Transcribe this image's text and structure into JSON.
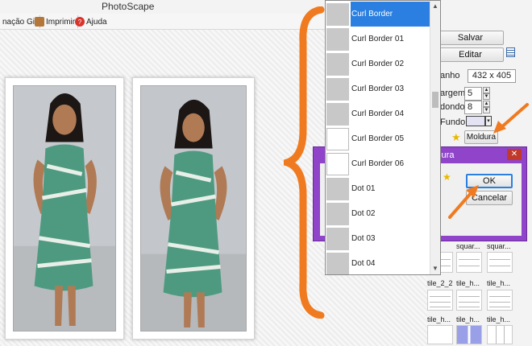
{
  "window": {
    "title": "PhotoScape",
    "minimize": "−",
    "restore": "❐",
    "close": "✕"
  },
  "toolbar": {
    "items": [
      {
        "label": "nação Gif",
        "icon": "gif-icon"
      },
      {
        "label": "Imprimir",
        "icon": "printer-icon"
      },
      {
        "label": "Ajuda",
        "icon": "help-icon"
      }
    ]
  },
  "frame_list": {
    "items": [
      {
        "label": "Curl Border",
        "selected": true
      },
      {
        "label": "Curl Border 01"
      },
      {
        "label": "Curl Border 02"
      },
      {
        "label": "Curl Border 03"
      },
      {
        "label": "Curl Border 04"
      },
      {
        "label": "Curl Border 05"
      },
      {
        "label": "Curl Border 06"
      },
      {
        "label": "Dot 01"
      },
      {
        "label": "Dot 02"
      },
      {
        "label": "Dot 03"
      },
      {
        "label": "Dot 04"
      }
    ],
    "scroll_up": "▲",
    "scroll_down": "▼"
  },
  "panel": {
    "save_label": "Salvar",
    "edit_label": "Editar",
    "size_label": "anho",
    "size_value": "432 x 405",
    "margin_label": "argem",
    "margin_value": "5",
    "round_label": "dondo",
    "round_value": "8",
    "background_label": "Fundo",
    "frame_label": "Moldura"
  },
  "dialog": {
    "title": "ldura",
    "ok_label": "OK",
    "cancel_label": "Cancelar",
    "close": "✕"
  },
  "thumbnails": {
    "names": [
      "squar...",
      "squar...",
      "tile_2_2",
      "tile_h...",
      "tile_h...",
      "tile_h...",
      "tile_h...",
      "tile_h..."
    ]
  },
  "colors": {
    "selection": "#2a7fe0",
    "dialog_frame": "#8f44c9",
    "annotation": "#f07a1f"
  }
}
